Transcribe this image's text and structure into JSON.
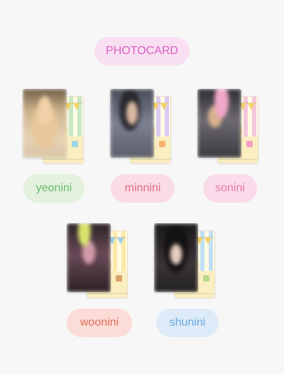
{
  "header": {
    "title": "PHOTOCARD",
    "color": "#d85fc4",
    "bg": "#f8dff1"
  },
  "members": [
    {
      "name": "yeonini",
      "text_color": "#6cba6e",
      "pill_bg": "#e3f1dd",
      "stripe": [
        "#c7e8c4",
        "#fffbe6"
      ]
    },
    {
      "name": "minnini",
      "text_color": "#e26b8c",
      "pill_bg": "#fadce4",
      "stripe": [
        "#dccaf1",
        "#fffbe6"
      ]
    },
    {
      "name": "sonini",
      "text_color": "#e679a8",
      "pill_bg": "#fadbe9",
      "stripe": [
        "#f6c6dd",
        "#fffbe6"
      ]
    },
    {
      "name": "woonini",
      "text_color": "#e36f5d",
      "pill_bg": "#fbdcd6",
      "stripe": [
        "#fbe9a7",
        "#fffbe6"
      ]
    },
    {
      "name": "shunini",
      "text_color": "#6aa8dd",
      "pill_bg": "#dcebf7",
      "stripe": [
        "#bfe0f4",
        "#fffbe6"
      ]
    }
  ]
}
